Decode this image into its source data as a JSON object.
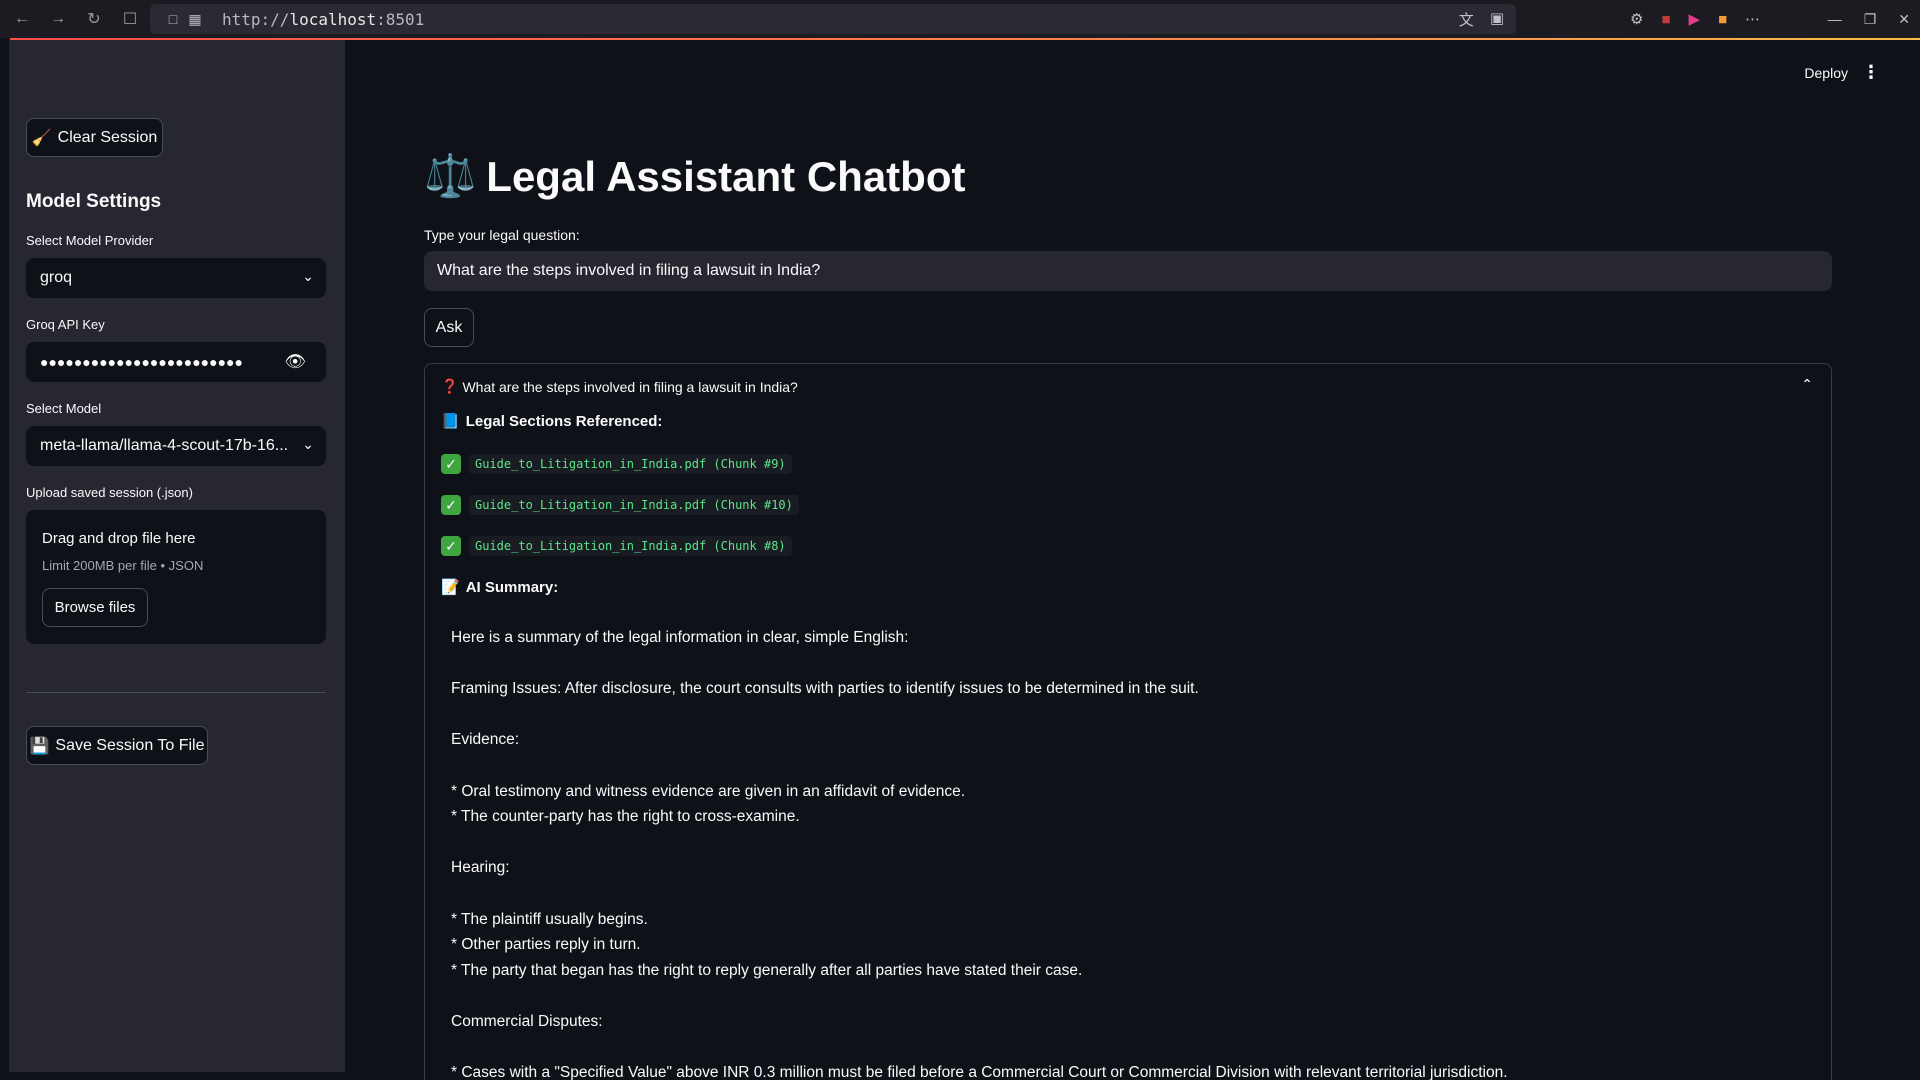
{
  "browser": {
    "url_scheme": "http://",
    "url_host": "localhost",
    "url_port": ":8501"
  },
  "sidebar": {
    "clear_button": "Clear Session",
    "clear_icon": "🧹",
    "heading": "Model Settings",
    "provider_label": "Select Model Provider",
    "provider_value": "groq",
    "api_key_label": "Groq API Key",
    "api_key_masked": "●●●●●●●●●●●●●●●●●●●●●●●●",
    "model_label": "Select Model",
    "model_value": "meta-llama/llama-4-scout-17b-16...",
    "upload_label": "Upload saved session (.json)",
    "upload_title": "Drag and drop file here",
    "upload_limit": "Limit 200MB per file • JSON",
    "browse_button": "Browse files",
    "save_button": "Save Session To File",
    "save_icon": "💾"
  },
  "header": {
    "deploy": "Deploy"
  },
  "main": {
    "title_icon": "⚖️",
    "title": "Legal Assistant Chatbot",
    "question_label": "Type your legal question:",
    "question_value": "What are the steps involved in filing a lawsuit in India?",
    "ask_button": "Ask",
    "expander_icon": "❓",
    "expander_title": "What are the steps involved in filing a lawsuit in India?",
    "sections_icon": "📘",
    "sections_heading": "Legal Sections Referenced:",
    "chunks": [
      "Guide_to_Litigation_in_India.pdf (Chunk #9)",
      "Guide_to_Litigation_in_India.pdf (Chunk #10)",
      "Guide_to_Litigation_in_India.pdf (Chunk #8)"
    ],
    "summary_icon": "📝",
    "summary_heading": "AI Summary:",
    "summary_lines": [
      "Here is a summary of the legal information in clear, simple English:",
      "",
      "Framing Issues: After disclosure, the court consults with parties to identify issues to be determined in the suit.",
      "",
      "Evidence:",
      "",
      "* Oral testimony and witness evidence are given in an affidavit of evidence.",
      "* The counter-party has the right to cross-examine.",
      "",
      "Hearing:",
      "",
      "* The plaintiff usually begins.",
      "* Other parties reply in turn.",
      "* The party that began has the right to reply generally after all parties have stated their case.",
      "",
      "Commercial Disputes:",
      "",
      "* Cases with a \"Specified Value\" above INR 0.3 million must be filed before a Commercial Court or Commercial Division with relevant territorial jurisdiction."
    ]
  }
}
